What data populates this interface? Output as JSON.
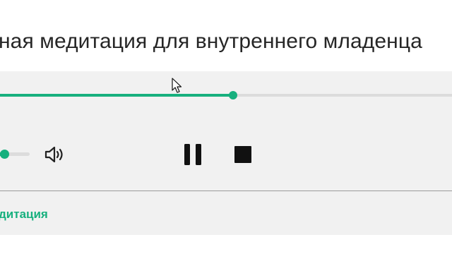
{
  "track": {
    "title": "ная медитация для внутреннего младенца"
  },
  "player": {
    "progress_fraction": 0.515,
    "volume_fraction": 0.15,
    "speaker_icon": "speaker-icon",
    "pause_icon": "pause-icon",
    "stop_icon": "stop-icon",
    "accent_color": "#17b07e",
    "background_color": "#f1f1f1"
  },
  "category": {
    "label": "дитация"
  }
}
